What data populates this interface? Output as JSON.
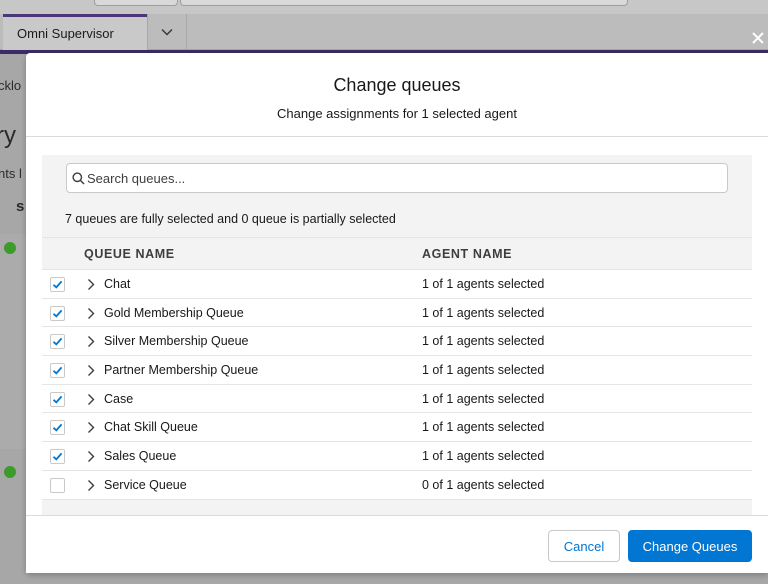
{
  "background": {
    "tab_label": "Omni Supervisor",
    "fragments": [
      "cklo",
      "ry",
      "nts l",
      "s"
    ]
  },
  "modal": {
    "title": "Change queues",
    "subtitle": "Change assignments for 1 selected agent",
    "search": {
      "placeholder": "Search queues..."
    },
    "summary": "7 queues are fully selected and 0 queue is partially selected",
    "table": {
      "headers": [
        "QUEUE NAME",
        "AGENT NAME"
      ],
      "rows": [
        {
          "name": "Chat",
          "agents": "1 of 1 agents selected",
          "checked": true
        },
        {
          "name": "Gold Membership Queue",
          "agents": "1 of 1 agents selected",
          "checked": true
        },
        {
          "name": "Silver Membership Queue",
          "agents": "1 of 1 agents selected",
          "checked": true
        },
        {
          "name": "Partner Membership Queue",
          "agents": "1 of 1 agents selected",
          "checked": true
        },
        {
          "name": "Case",
          "agents": "1 of 1 agents selected",
          "checked": true
        },
        {
          "name": "Chat Skill Queue",
          "agents": "1 of 1 agents selected",
          "checked": true
        },
        {
          "name": "Sales Queue",
          "agents": "1 of 1 agents selected",
          "checked": true
        },
        {
          "name": "Service Queue",
          "agents": "0 of 1 agents selected",
          "checked": false
        }
      ]
    },
    "footer": {
      "cancel_label": "Cancel",
      "primary_label": "Change Queues"
    }
  },
  "colors": {
    "brand": "#0176d3",
    "check": "#0176d3",
    "tab_accent": "#4a3876"
  },
  "icons": [
    "search-icon",
    "chevron-right-icon",
    "check-icon",
    "close-icon",
    "chevron-down-icon"
  ]
}
